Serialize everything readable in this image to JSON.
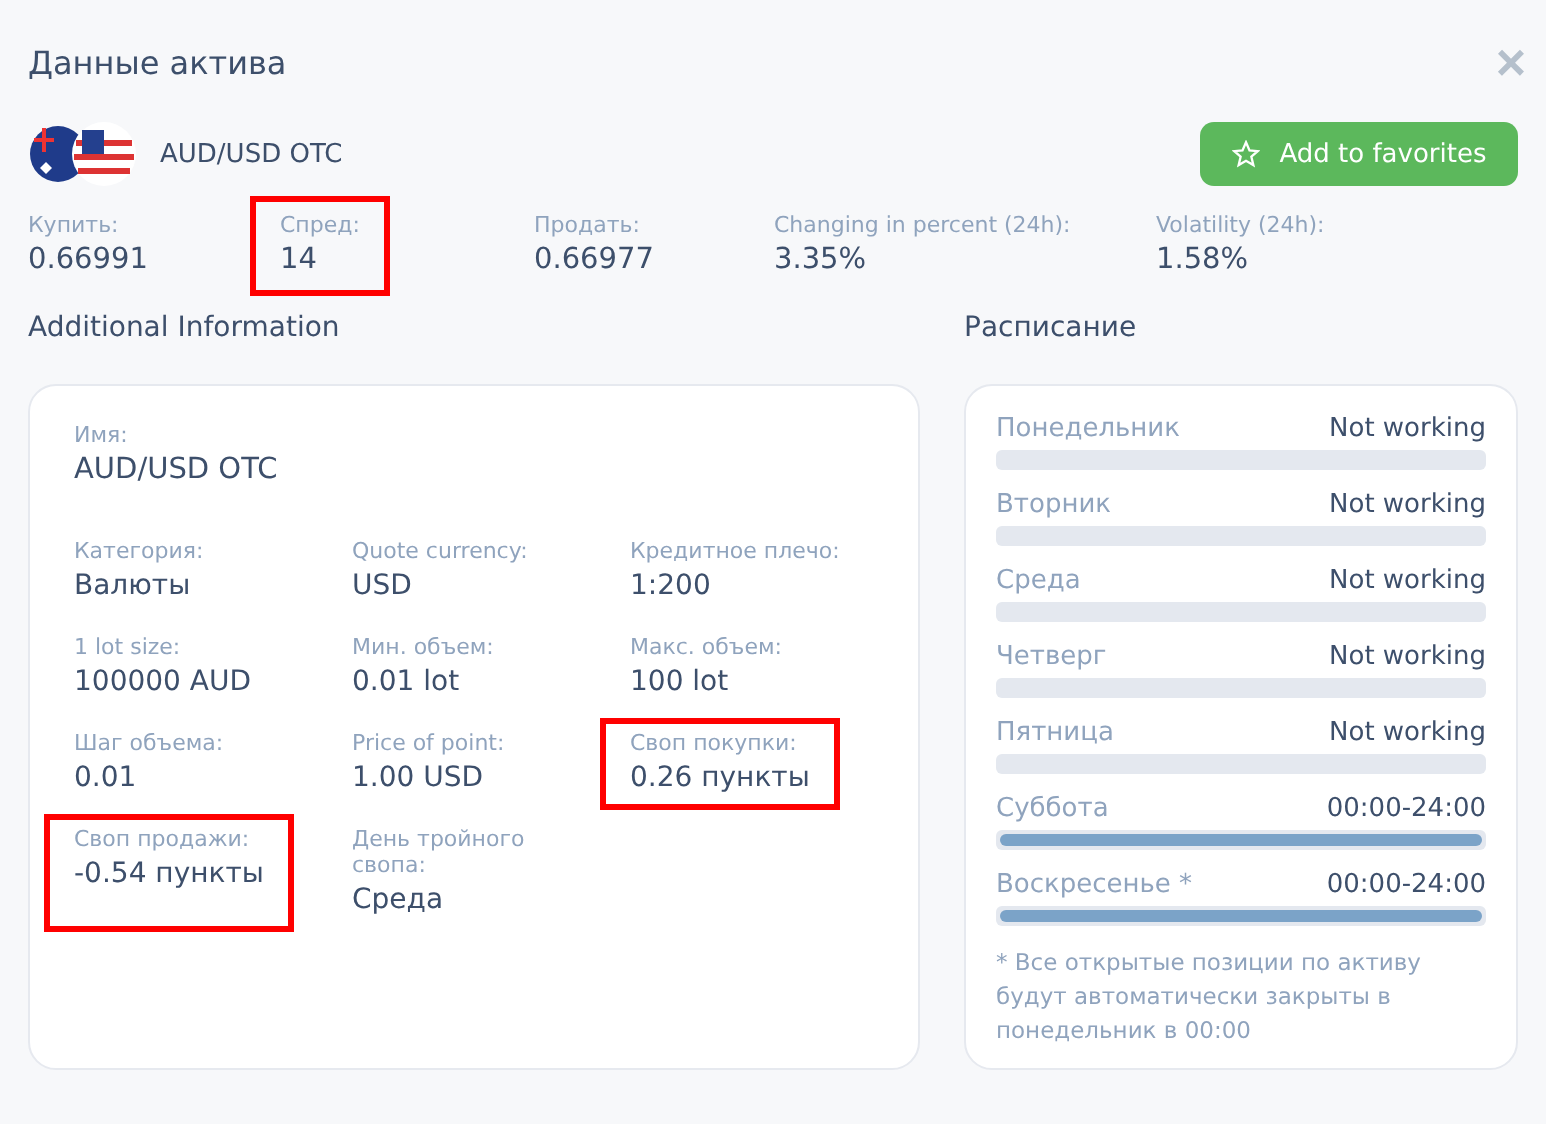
{
  "dialog": {
    "title": "Данные актива",
    "close": "×"
  },
  "asset": {
    "name": "AUD/USD OTC",
    "favorite_button": "Add to favorites"
  },
  "stats": [
    {
      "label": "Купить:",
      "value": "0.66991",
      "highlighted": false
    },
    {
      "label": "Спред:",
      "value": "14",
      "highlighted": true
    },
    {
      "label": "Продать:",
      "value": "0.66977",
      "highlighted": false
    },
    {
      "label": "Changing in percent (24h):",
      "value": "3.35%",
      "highlighted": false
    },
    {
      "label": "Volatility (24h):",
      "value": "1.58%",
      "highlighted": false
    }
  ],
  "additional": {
    "title": "Additional Information",
    "name_label": "Имя:",
    "name_value": "AUD/USD OTC",
    "fields": [
      {
        "label": "Категория:",
        "value": "Валюты",
        "highlighted": false
      },
      {
        "label": "Quote currency:",
        "value": "USD",
        "highlighted": false
      },
      {
        "label": "Кредитное плечо:",
        "value": "1:200",
        "highlighted": false
      },
      {
        "label": "1 lot size:",
        "value": "100000 AUD",
        "highlighted": false
      },
      {
        "label": "Мин. объем:",
        "value": "0.01 lot",
        "highlighted": false
      },
      {
        "label": "Макс. объем:",
        "value": "100 lot",
        "highlighted": false
      },
      {
        "label": "Шаг объема:",
        "value": "0.01",
        "highlighted": false
      },
      {
        "label": "Price of point:",
        "value": "1.00 USD",
        "highlighted": false
      },
      {
        "label": "Своп покупки:",
        "value": "0.26 пункты",
        "highlighted": true
      },
      {
        "label": "Своп продажи:",
        "value": "-0.54 пункты",
        "highlighted": true
      },
      {
        "label": "День тройного свопа:",
        "value": "Среда",
        "highlighted": false
      }
    ]
  },
  "schedule": {
    "title": "Расписание",
    "days": [
      {
        "day": "Понедельник",
        "hours": "Not working",
        "level": 0
      },
      {
        "day": "Вторник",
        "hours": "Not working",
        "level": 0
      },
      {
        "day": "Среда",
        "hours": "Not working",
        "level": 0
      },
      {
        "day": "Четверг",
        "hours": "Not working",
        "level": 0
      },
      {
        "day": "Пятница",
        "hours": "Not working",
        "level": 0
      },
      {
        "day": "Суббота",
        "hours": "00:00-24:00",
        "level": 1
      },
      {
        "day": "Воскресенье *",
        "hours": "00:00-24:00",
        "level": 1
      }
    ],
    "note": "* Все открытые позиции по активу будут автоматически закрыты в понедельник в 00:00"
  }
}
